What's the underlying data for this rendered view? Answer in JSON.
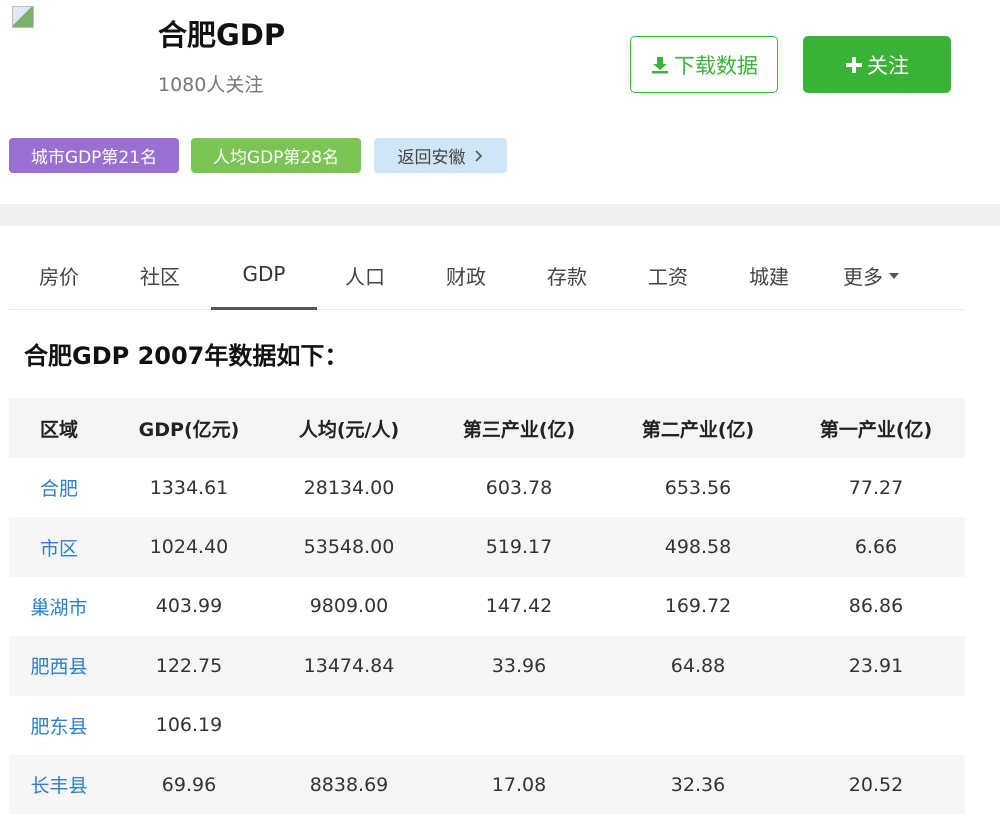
{
  "header": {
    "title": "合肥GDP",
    "followers": "1080人关注",
    "download_label": "下载数据",
    "follow_label": "关注",
    "download_icon": "download-icon",
    "follow_icon": "plus-icon"
  },
  "tags": {
    "rank": "城市GDP第21名",
    "percap": "人均GDP第28名",
    "back": "返回安徽"
  },
  "tabs": [
    {
      "label": "房价"
    },
    {
      "label": "社区"
    },
    {
      "label": "GDP"
    },
    {
      "label": "人口"
    },
    {
      "label": "财政"
    },
    {
      "label": "存款"
    },
    {
      "label": "工资"
    },
    {
      "label": "城建"
    },
    {
      "label": "更多"
    }
  ],
  "active_tab": "GDP",
  "heading": "合肥GDP 2007年数据如下：",
  "table": {
    "columns": [
      "区域",
      "GDP(亿元)",
      "人均(元/人)",
      "第三产业(亿)",
      "第二产业(亿)",
      "第一产业(亿)"
    ],
    "rows": [
      [
        "合肥",
        "1334.61",
        "28134.00",
        "603.78",
        "653.56",
        "77.27"
      ],
      [
        "市区",
        "1024.40",
        "53548.00",
        "519.17",
        "498.58",
        "6.66"
      ],
      [
        "巢湖市",
        "403.99",
        "9809.00",
        "147.42",
        "169.72",
        "86.86"
      ],
      [
        "肥西县",
        "122.75",
        "13474.84",
        "33.96",
        "64.88",
        "23.91"
      ],
      [
        "肥东县",
        "106.19",
        "",
        "",
        "",
        ""
      ],
      [
        "长丰县",
        "69.96",
        "8838.69",
        "17.08",
        "32.36",
        "20.52"
      ]
    ]
  },
  "colors": {
    "green": "#39b335",
    "purple": "#9a6fd2",
    "light_green": "#7cc454",
    "light_blue": "#cfe6f7",
    "link_blue": "#2d7fc9"
  }
}
